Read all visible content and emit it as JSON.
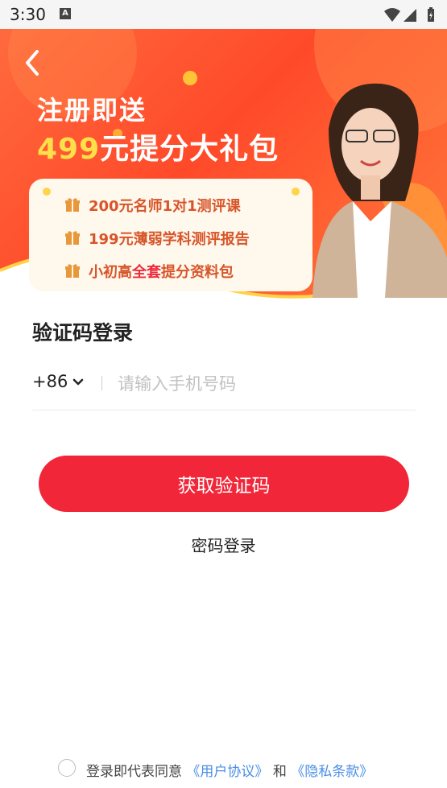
{
  "status_bar": {
    "time": "3:30",
    "notification_badge": "A"
  },
  "banner": {
    "title": "注册即送",
    "subtitle_number": "499",
    "subtitle_text": "元提分大礼包",
    "items": [
      {
        "text": "200元名师1对1测评课"
      },
      {
        "text": "199元薄弱学科测评报告"
      },
      {
        "prefix": "小初高",
        "highlight": "全套",
        "suffix": "提分资料包"
      }
    ]
  },
  "login": {
    "title": "验证码登录",
    "country_code": "+86",
    "phone_placeholder": "请输入手机号码",
    "phone_value": "",
    "get_code_label": "获取验证码",
    "password_login_label": "密码登录"
  },
  "agreement": {
    "prefix": "登录即代表同意",
    "user_agreement": "《用户协议》",
    "and": "和",
    "privacy_policy": "《隐私条款》"
  },
  "colors": {
    "accent_red": "#f12638",
    "banner_orange": "#ff5a30",
    "link_blue": "#4a8ee6",
    "highlight_yellow": "#ffe04a"
  },
  "icons": [
    "back-arrow-icon",
    "gift-icon",
    "chevron-down-icon",
    "wifi-icon",
    "signal-icon",
    "battery-icon"
  ]
}
